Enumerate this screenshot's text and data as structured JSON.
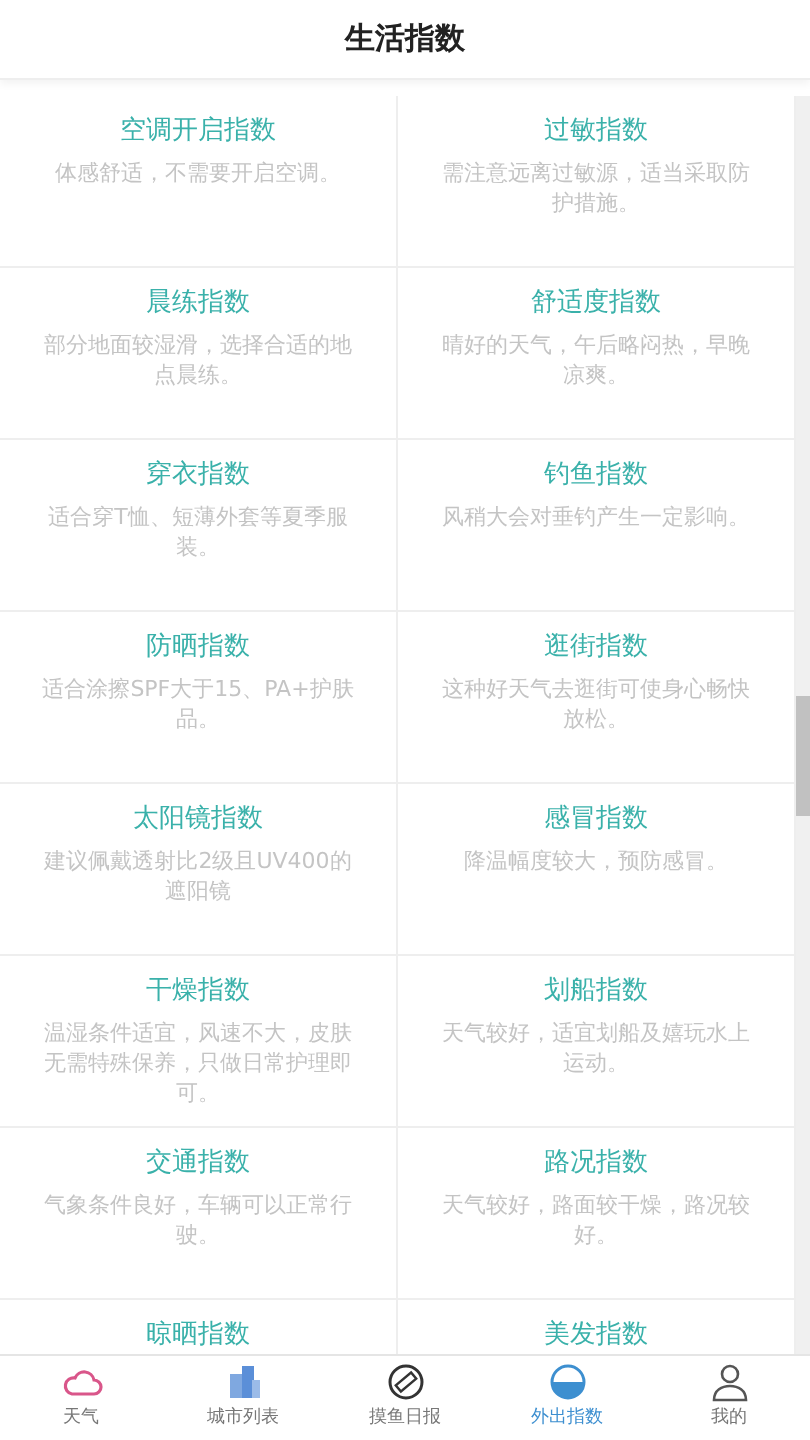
{
  "header": {
    "title": "生活指数"
  },
  "indices": [
    {
      "title": "空调开启指数",
      "description": "体感舒适，不需要开启空调。"
    },
    {
      "title": "过敏指数",
      "description": "需注意远离过敏源，适当采取防护措施。"
    },
    {
      "title": "晨练指数",
      "description": "部分地面较湿滑，选择合适的地点晨练。"
    },
    {
      "title": "舒适度指数",
      "description": "晴好的天气，午后略闷热，早晚凉爽。"
    },
    {
      "title": "穿衣指数",
      "description": "适合穿T恤、短薄外套等夏季服装。"
    },
    {
      "title": "钓鱼指数",
      "description": "风稍大会对垂钓产生一定影响。"
    },
    {
      "title": "防晒指数",
      "description": "适合涂擦SPF大于15、PA+护肤品。"
    },
    {
      "title": "逛街指数",
      "description": "这种好天气去逛街可使身心畅快放松。"
    },
    {
      "title": "太阳镜指数",
      "description": "建议佩戴透射比2级且UV400的遮阳镜"
    },
    {
      "title": "感冒指数",
      "description": "降温幅度较大，预防感冒。"
    },
    {
      "title": "干燥指数",
      "description": "温湿条件适宜，风速不大，皮肤无需特殊保养，只做日常护理即可。"
    },
    {
      "title": "划船指数",
      "description": "天气较好，适宜划船及嬉玩水上运动。"
    },
    {
      "title": "交通指数",
      "description": "气象条件良好，车辆可以正常行驶。"
    },
    {
      "title": "路况指数",
      "description": "天气较好，路面较干燥，路况较好。"
    },
    {
      "title": "晾晒指数"
    },
    {
      "title": "美发指数"
    }
  ],
  "tabbar": [
    {
      "label": "天气",
      "kind": "cloud",
      "selected": false
    },
    {
      "label": "城市列表",
      "kind": "city",
      "selected": false
    },
    {
      "label": "摸鱼日报",
      "kind": "report",
      "selected": false
    },
    {
      "label": "外出指数",
      "kind": "globe",
      "selected": true
    },
    {
      "label": "我的",
      "kind": "user",
      "selected": false
    }
  ]
}
